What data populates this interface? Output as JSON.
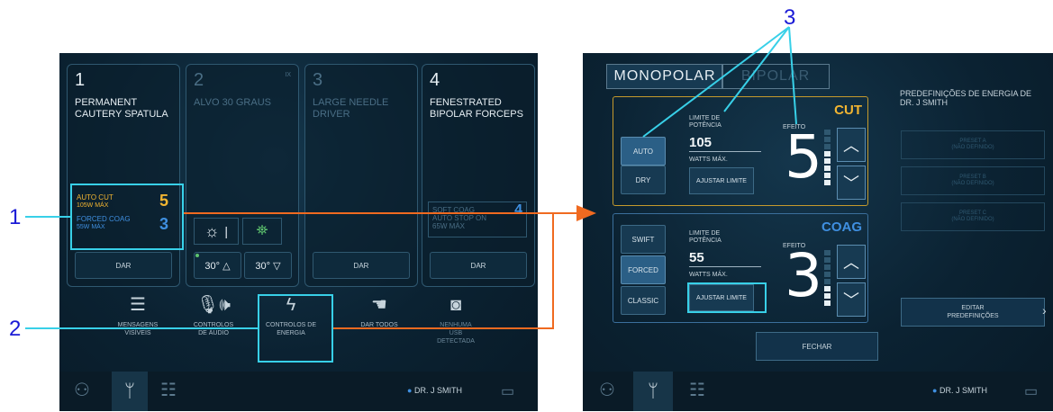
{
  "callouts": {
    "n1": "1",
    "n2": "2",
    "n3": "3"
  },
  "left": {
    "cards": [
      {
        "num": "1",
        "name": "PERMANENT CAUTERY SPATULA",
        "button": "DAR"
      },
      {
        "num": "2",
        "name": "ALVO 30 GRAUS",
        "badge": "IX",
        "buttons": [
          "30° △",
          "30° ▽"
        ]
      },
      {
        "num": "3",
        "name": "LARGE NEEDLE DRIVER",
        "button": "DAR"
      },
      {
        "num": "4",
        "name": "FENESTRATED BIPOLAR FORCEPS",
        "button": "DAR"
      }
    ],
    "energy1": {
      "cut_label": "AUTO CUT",
      "cut_max": "105W MÁX",
      "cut_value": "5",
      "coag_label": "FORCED COAG",
      "coag_max": "55W MÁX",
      "coag_value": "3"
    },
    "energy4": {
      "line1": "SOFT COAG",
      "line2": "AUTO STOP ON",
      "line3": "65W MÁX",
      "value": "4"
    },
    "nav": [
      {
        "l1": "MENSAGENS",
        "l2": "VISÍVEIS",
        "icon": "list-icon"
      },
      {
        "l1": "CONTROLOS",
        "l2": "DE ÁUDIO",
        "icon": "audio-icon"
      },
      {
        "l1": "CONTROLOS DE",
        "l2": "ENERGIA",
        "icon": "lightning-icon"
      },
      {
        "l1": "DAR TODOS",
        "l2": "",
        "icon": "hand-icon"
      },
      {
        "l1": "NENHUMA",
        "l2": "USB",
        "l3": "DETECTADA",
        "icon": "usb-camera-icon"
      }
    ],
    "user": "DR. J SMITH"
  },
  "right": {
    "tab_mono": "MONOPOLAR",
    "tab_bipo": "BIPOLAR",
    "cut": {
      "title": "CUT",
      "modes": [
        "AUTO",
        "DRY"
      ],
      "limit_label": "LIMITE DE POTÊNCIA",
      "watts": "105",
      "watts_label": "WATTS MÁX.",
      "adjust": "AJUSTAR LIMITE",
      "effect_label": "EFEITO",
      "effect": "5",
      "level": 5,
      "color": "#f2b531"
    },
    "coag": {
      "title": "COAG",
      "modes": [
        "SWIFT",
        "FORCED",
        "CLASSIC"
      ],
      "limit_label": "LIMITE DE POTÊNCIA",
      "watts": "55",
      "watts_label": "WATTS MÁX.",
      "adjust": "AJUSTAR LIMITE",
      "effect_label": "EFEITO",
      "effect": "3",
      "level": 3,
      "color": "#3f8fe0"
    },
    "presets_title": "PREDEFINIÇÕES DE ENERGIA DE DR. J SMITH",
    "presets": [
      {
        "l1": "PRESET A",
        "l2": "(NÃO DEFINIDO)"
      },
      {
        "l1": "PRESET B",
        "l2": "(NÃO DEFINIDO)"
      },
      {
        "l1": "PRESET C",
        "l2": "(NÃO DEFINIDO)"
      }
    ],
    "edit_presets": "EDITAR PREDEFINIÇÕES",
    "close": "FECHAR",
    "user": "DR. J SMITH"
  }
}
